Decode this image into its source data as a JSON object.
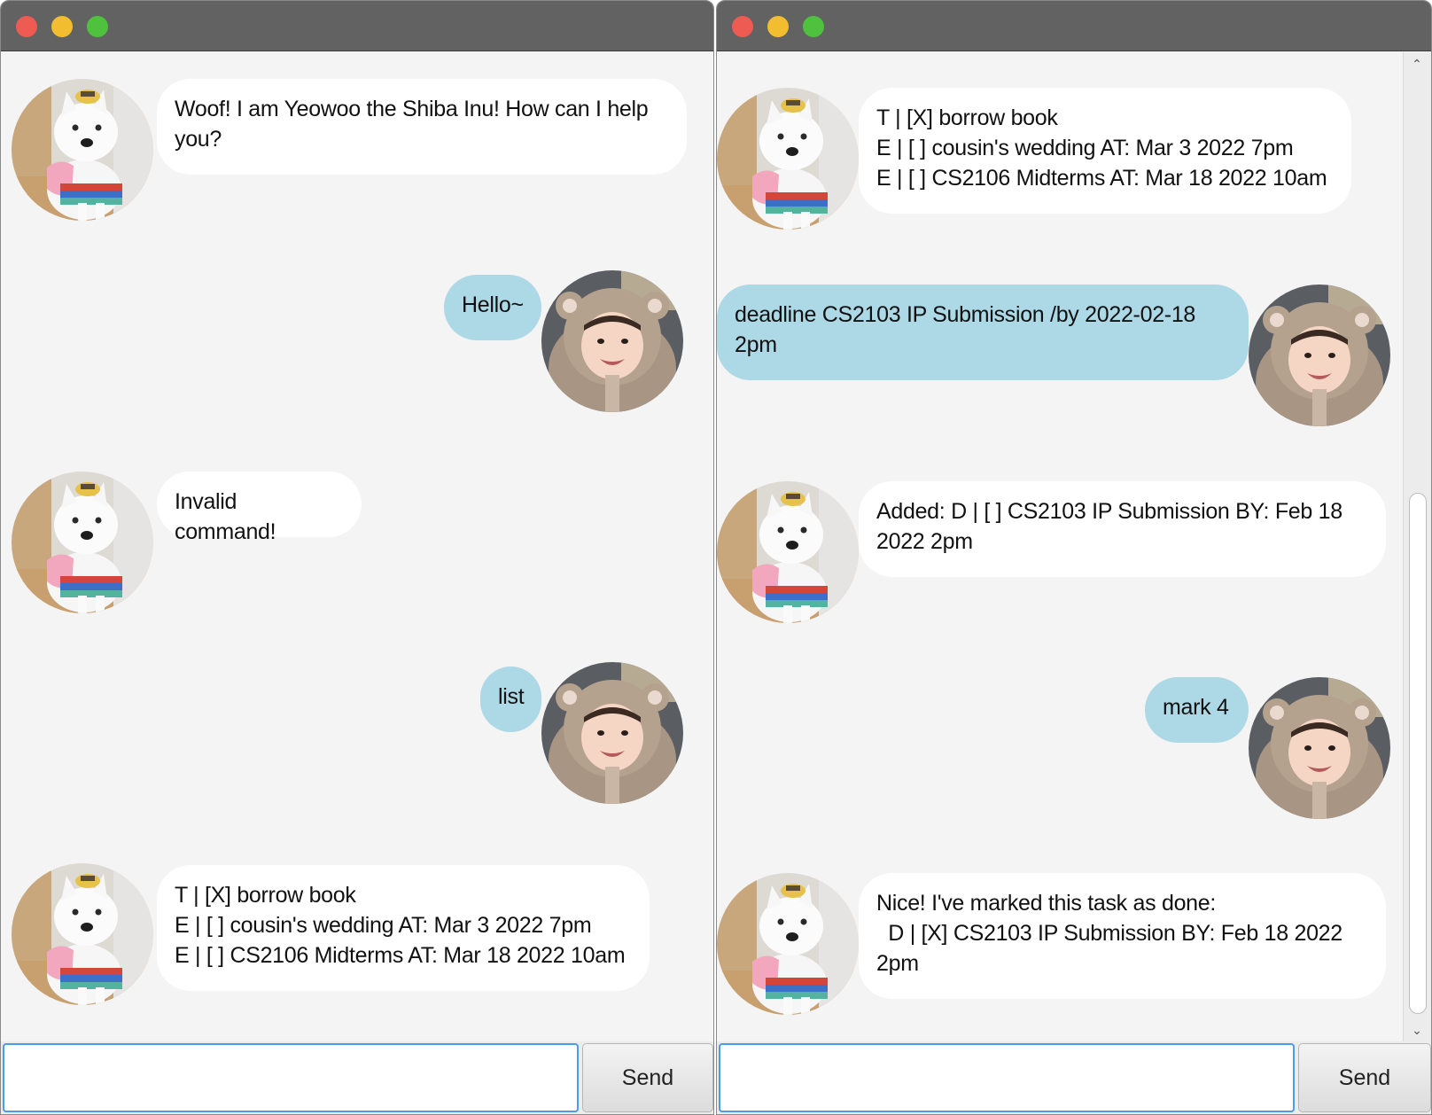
{
  "left_window": {
    "messages": [
      {
        "sender": "bot",
        "text": "Woof! I am Yeowoo the Shiba Inu! How can I help\nyou?"
      },
      {
        "sender": "user",
        "text": "Hello~"
      },
      {
        "sender": "bot",
        "text": "Invalid command!"
      },
      {
        "sender": "user",
        "text": "list"
      },
      {
        "sender": "bot",
        "text": "T | [X] borrow book\nE | [ ] cousin's wedding AT: Mar 3 2022 7pm\nE | [ ] CS2106 Midterms AT: Mar 18 2022 10am"
      }
    ],
    "input": {
      "value": "",
      "placeholder": ""
    },
    "send_label": "Send"
  },
  "right_window": {
    "messages": [
      {
        "sender": "bot",
        "text": "T | [X] borrow book\nE | [ ] cousin's wedding AT: Mar 3 2022 7pm\nE | [ ] CS2106 Midterms AT: Mar 18 2022 10am"
      },
      {
        "sender": "user",
        "text": "deadline CS2103 IP Submission /by 2022-02-18\n2pm"
      },
      {
        "sender": "bot",
        "text": "Added: D | [ ] CS2103 IP Submission BY: Feb 18\n2022 2pm"
      },
      {
        "sender": "user",
        "text": "mark 4"
      },
      {
        "sender": "bot",
        "text": "Nice! I've marked this task as done:\n  D | [X] CS2103 IP Submission BY: Feb 18 2022\n2pm"
      }
    ],
    "input": {
      "value": "",
      "placeholder": ""
    },
    "send_label": "Send"
  },
  "icons": {
    "bot_avatar": "shiba-inu-dog-avatar-icon",
    "user_avatar": "baby-in-bear-hood-avatar-icon",
    "scroll_up": "chevron-up-icon",
    "scroll_down": "chevron-down-icon"
  },
  "colors": {
    "user_bubble": "#add8e6",
    "bot_bubble": "#ffffff",
    "chat_background": "#f4f4f4",
    "titlebar": "#626262",
    "close": "#ee5b52",
    "minimize": "#f2be2f",
    "maximize": "#4fc13f",
    "input_focus": "#4a9be8"
  }
}
